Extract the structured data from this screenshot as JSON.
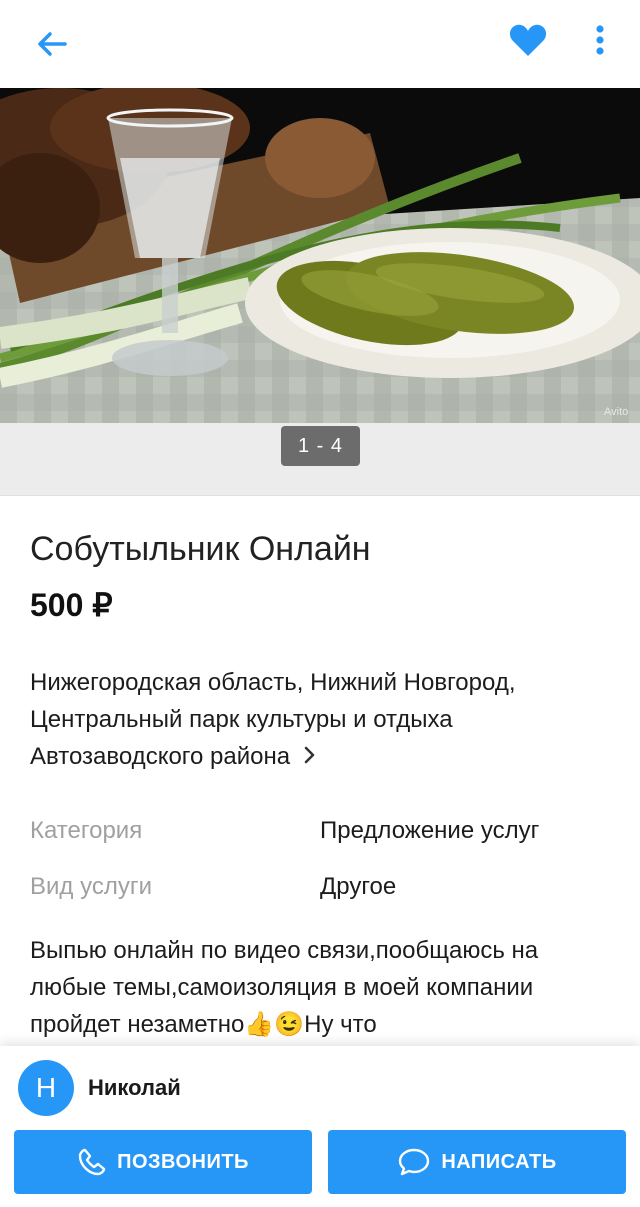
{
  "icons": {
    "back": "arrow-left-icon",
    "favorite": "heart-icon",
    "more": "more-vertical-icon",
    "call": "phone-icon",
    "message": "chat-bubble-icon"
  },
  "colors": {
    "accent": "#2797f7",
    "counter_bg": "#6c6c6c",
    "label_gray": "#a0a0a0"
  },
  "gallery": {
    "counter": "1 - 4",
    "watermark": "Avito"
  },
  "listing": {
    "title": "Собутыльник Онлайн",
    "price": "500 ₽",
    "address": "Нижегородская область, Нижний Новгород, Центральный парк культуры и отдыха Автозаводского района",
    "params": [
      {
        "label": "Категория",
        "value": "Предложение услуг"
      },
      {
        "label": "Вид услуги",
        "value": "Другое"
      }
    ],
    "description": "Выпью онлайн по видео связи,пообщаюсь на любые темы,самоизоляция в моей компании пройдет незаметно👍😉Ну что"
  },
  "seller": {
    "initial": "Н",
    "name": "Николай"
  },
  "actions": {
    "call_label": "ПОЗВОНИТЬ",
    "write_label": "НАПИСАТЬ"
  }
}
